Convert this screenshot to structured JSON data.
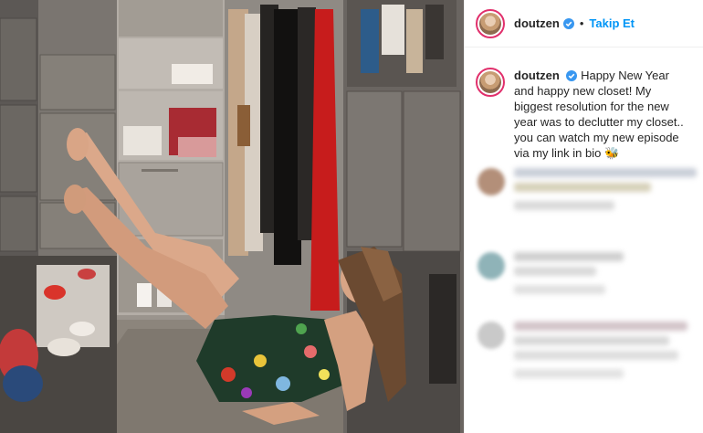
{
  "post": {
    "username": "doutzen",
    "follow_label": "Takip Et",
    "separator": "•",
    "caption_text": "Happy New Year and happy new closet! My biggest resolution for the new year was to declutter my closet.. you can watch my new episode via my link in bio 🐝"
  },
  "colors": {
    "follow_blue": "#0095f6",
    "verified_blue": "#3897f0",
    "text": "#262626"
  },
  "icons": {
    "verified": "verified-badge-icon"
  },
  "photo": {
    "description_icon": "closet-photo"
  }
}
